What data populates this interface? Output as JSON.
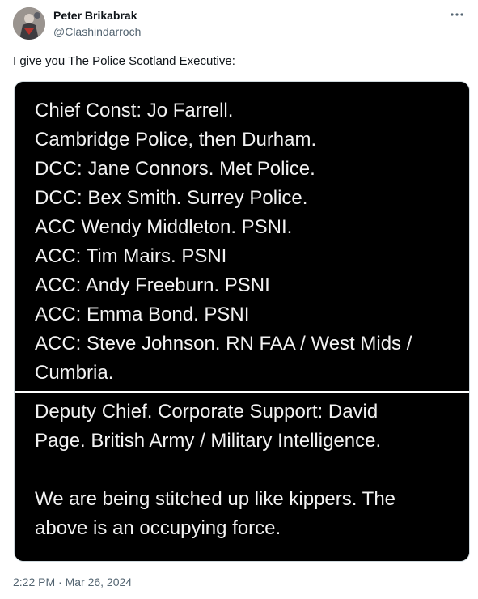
{
  "author": {
    "display_name": "Peter Brikabrak",
    "handle": "@Clashindarroch",
    "avatar_icon": "avatar-photo"
  },
  "more_icon": "more-horizontal-icon",
  "tweet": {
    "text": "I give you The Police Scotland Executive:",
    "timestamp": "2:22 PM · Mar 26, 2024"
  },
  "image": {
    "top_lines": [
      "Chief Const: Jo Farrell.",
      "Cambridge Police, then Durham.",
      "DCC: Jane Connors. Met Police.",
      "DCC: Bex Smith. Surrey Police.",
      "ACC Wendy Middleton. PSNI.",
      "ACC: Tim Mairs. PSNI",
      "ACC: Andy Freeburn. PSNI",
      "ACC: Emma Bond. PSNI",
      "ACC: Steve Johnson. RN FAA / West Mids /",
      "Cumbria."
    ],
    "bottom_lines": [
      "Deputy Chief. Corporate Support: David",
      "Page. British Army / Military Intelligence.",
      "We are being stitched up like kippers. The",
      "above is an occupying force."
    ]
  },
  "colors": {
    "text_primary": "#0f1419",
    "text_secondary": "#536471",
    "image_background": "#000000",
    "image_text": "#f2f2f2"
  }
}
